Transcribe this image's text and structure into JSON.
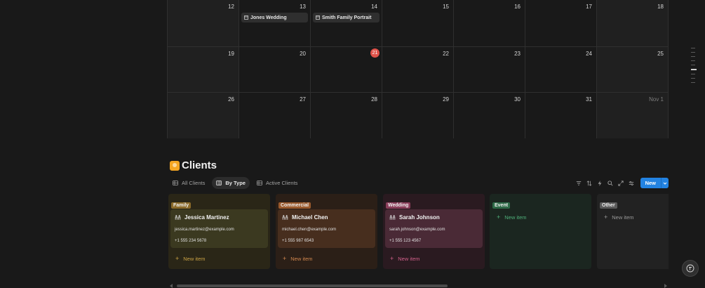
{
  "calendar": {
    "weeks": [
      {
        "days": [
          {
            "label": "12",
            "weekend": true
          },
          {
            "label": "13",
            "event": "Jones Wedding"
          },
          {
            "label": "14",
            "event": "Smith Family Portrait"
          },
          {
            "label": "15"
          },
          {
            "label": "16"
          },
          {
            "label": "17"
          },
          {
            "label": "18",
            "weekend": true
          }
        ]
      },
      {
        "days": [
          {
            "label": "19",
            "weekend": true
          },
          {
            "label": "20"
          },
          {
            "label": "21",
            "today": true
          },
          {
            "label": "22"
          },
          {
            "label": "23"
          },
          {
            "label": "24"
          },
          {
            "label": "25",
            "weekend": true
          }
        ]
      },
      {
        "days": [
          {
            "label": "26",
            "weekend": true
          },
          {
            "label": "27"
          },
          {
            "label": "28"
          },
          {
            "label": "29"
          },
          {
            "label": "30"
          },
          {
            "label": "31"
          },
          {
            "label": "Nov 1",
            "weekend": true,
            "muted": true
          }
        ]
      }
    ]
  },
  "clients": {
    "title": "Clients",
    "icon": "raised-hand-emoji-icon",
    "tabs": [
      {
        "label": "All Clients",
        "icon": "table-icon",
        "active": false
      },
      {
        "label": "By Type",
        "icon": "board-icon",
        "active": true
      },
      {
        "label": "Active Clients",
        "icon": "table-icon",
        "active": false
      }
    ],
    "toolbar": {
      "icons": [
        "filter-icon",
        "sort-icon",
        "automation-icon",
        "search-icon",
        "expand-icon",
        "settings-icon"
      ],
      "new_label": "New"
    },
    "columns": [
      {
        "tag": "Family",
        "tag_color": "#8b6a2a",
        "bg": "#2a2617",
        "card_bg": "#3b3920",
        "accent": "#c9a245",
        "card": {
          "name": "Jessica Martinez",
          "email": "jessica.martinez@example.com",
          "phone": "+1 555 234 5678"
        },
        "new_item": "New item"
      },
      {
        "tag": "Commercial",
        "tag_color": "#9a5a2d",
        "bg": "#2b1f17",
        "card_bg": "#472e1e",
        "accent": "#d2874f",
        "card": {
          "name": "Michael Chen",
          "email": "michael.chen@example.com",
          "phone": "+1 555 987 6543"
        },
        "new_item": "New item"
      },
      {
        "tag": "Wedding",
        "tag_color": "#8a3e5a",
        "bg": "#2a1a20",
        "card_bg": "#4a2a36",
        "accent": "#d1608a",
        "card": {
          "name": "Sarah Johnson",
          "email": "sarah.johnson@example.com",
          "phone": "+1 555 123 4567"
        },
        "new_item": "New item"
      },
      {
        "tag": "Event",
        "tag_color": "#2e6a48",
        "bg": "#1b2620",
        "accent": "#4fb07a",
        "new_item": "New item"
      },
      {
        "tag": "Other",
        "tag_color": "#5a5a5a",
        "bg": "#222222",
        "accent": "#9a9a9a",
        "new_item": "New item"
      }
    ]
  }
}
